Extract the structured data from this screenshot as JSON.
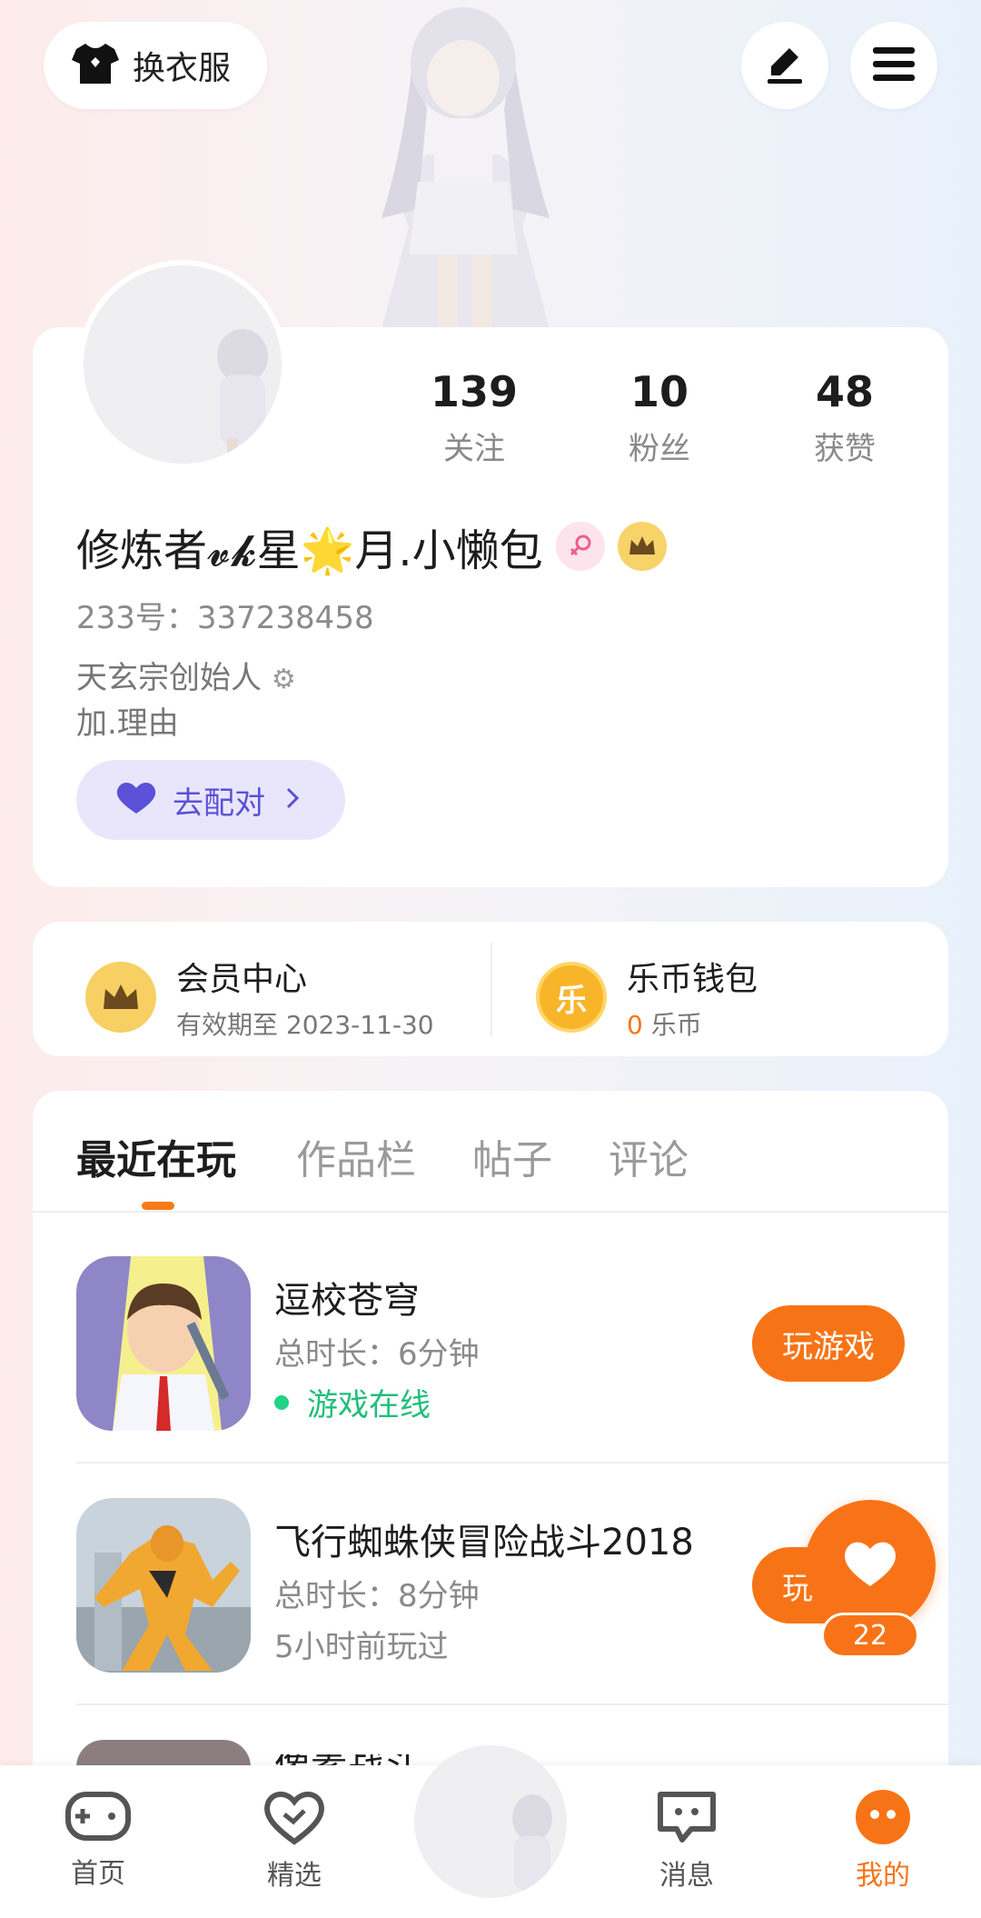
{
  "header": {
    "outfit_label": "换衣服",
    "icons": {
      "outfit": "shirt-icon",
      "edit": "pencil-icon",
      "menu": "hamburger-menu-icon"
    }
  },
  "profile": {
    "stats": [
      {
        "value": "139",
        "label": "关注"
      },
      {
        "value": "10",
        "label": "粉丝"
      },
      {
        "value": "48",
        "label": "获赞"
      }
    ],
    "nickname": "修炼者𝓿𝓴星🌟月.小懒包",
    "gender_badge": "female-icon",
    "vip_badge": "crown-icon",
    "uid": "233号：337238458",
    "bio_line1": "天玄宗创始人",
    "bio_line2": "加.理由",
    "match_label": "去配对"
  },
  "member": {
    "vip_title": "会员中心",
    "vip_sub": "有效期至 2023-11-30",
    "wallet_title": "乐币钱包",
    "wallet_icon_char": "乐",
    "wallet_amount": "0",
    "wallet_unit": " 乐币"
  },
  "tabs": [
    "最近在玩",
    "作品栏",
    "帖子",
    "评论"
  ],
  "games": [
    {
      "title": "逗校苍穹",
      "duration": "总时长：6分钟",
      "status": "游戏在线",
      "button": "玩游戏"
    },
    {
      "title": "飞行蜘蛛侠冒险战斗2018",
      "duration": "总时长：8分钟",
      "status": "5小时前玩过",
      "button": "玩游戏"
    },
    {
      "title": "像素战斗"
    }
  ],
  "like": {
    "count": "22"
  },
  "nav": [
    {
      "label": "首页",
      "icon": "gamepad-icon"
    },
    {
      "label": "精选",
      "icon": "heart-check-icon"
    },
    {
      "label": "消息",
      "icon": "chat-bubble-icon"
    },
    {
      "label": "我的",
      "icon": "smiley-icon"
    }
  ],
  "colors": {
    "accent": "#f77416",
    "purple": "#5a51d6",
    "online": "#22d386"
  }
}
